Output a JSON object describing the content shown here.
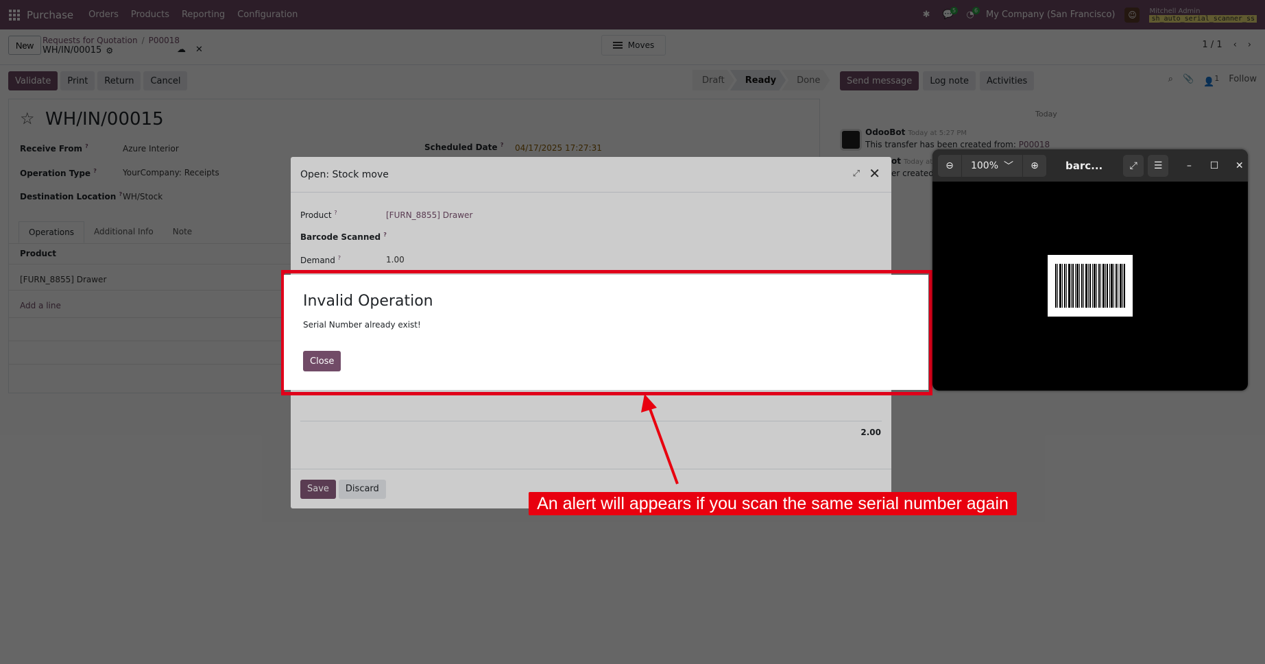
{
  "navbar": {
    "app_name": "Purchase",
    "menu": [
      "Orders",
      "Products",
      "Reporting",
      "Configuration"
    ],
    "company": "My Company (San Francisco)",
    "user": "Mitchell Admin",
    "database": "sh_auto_serial_scanner_ss",
    "chat_badge": "5",
    "activity_badge": "6"
  },
  "control_panel": {
    "new_label": "New",
    "breadcrumb": [
      "Requests for Quotation",
      "P00018"
    ],
    "record": "WH/IN/00015",
    "moves_label": "Moves",
    "pager": "1 / 1"
  },
  "actions": {
    "validate": "Validate",
    "print": "Print",
    "return": "Return",
    "cancel": "Cancel"
  },
  "statusbar": [
    "Draft",
    "Ready",
    "Done"
  ],
  "statusbar_active": "Ready",
  "form": {
    "title": "WH/IN/00015",
    "receive_from_label": "Receive From",
    "receive_from": "Azure Interior",
    "operation_type_label": "Operation Type",
    "operation_type": "YourCompany: Receipts",
    "destination_label": "Destination Location",
    "destination": "WH/Stock",
    "scheduled_date_label": "Scheduled Date",
    "scheduled_date": "04/17/2025 17:27:31",
    "tabs": [
      "Operations",
      "Additional Info",
      "Note"
    ],
    "ops_header": "Product",
    "ops_row": "[FURN_8855] Drawer",
    "add_line": "Add a line"
  },
  "chatter": {
    "send_message": "Send message",
    "log_note": "Log note",
    "activities": "Activities",
    "followers_count": "1",
    "follow": "Follow",
    "date_separator": "Today",
    "author": "OdooBot",
    "time": "Today at 5:27 PM",
    "message_prefix": "This transfer has been created from:",
    "message_link": "P00018",
    "author2": "ot",
    "time2": "Today at 5",
    "message2": "er created"
  },
  "stock_move_modal": {
    "title": "Open: Stock move",
    "product_label": "Product",
    "product": "[FURN_8855] Drawer",
    "barcode_label": "Barcode Scanned",
    "demand_label": "Demand",
    "demand": "1.00",
    "total": "2.00",
    "save": "Save",
    "discard": "Discard"
  },
  "alert": {
    "title": "Invalid Operation",
    "message": "Serial Number already exist!",
    "close": "Close"
  },
  "viewer": {
    "zoom": "100%",
    "title": "barc..."
  },
  "annotation": {
    "text": "An alert will appears if you scan the same serial number again"
  },
  "colors": {
    "brand": "#714b67",
    "annotation": "#e8000f",
    "viewer_bg": "#000000"
  }
}
